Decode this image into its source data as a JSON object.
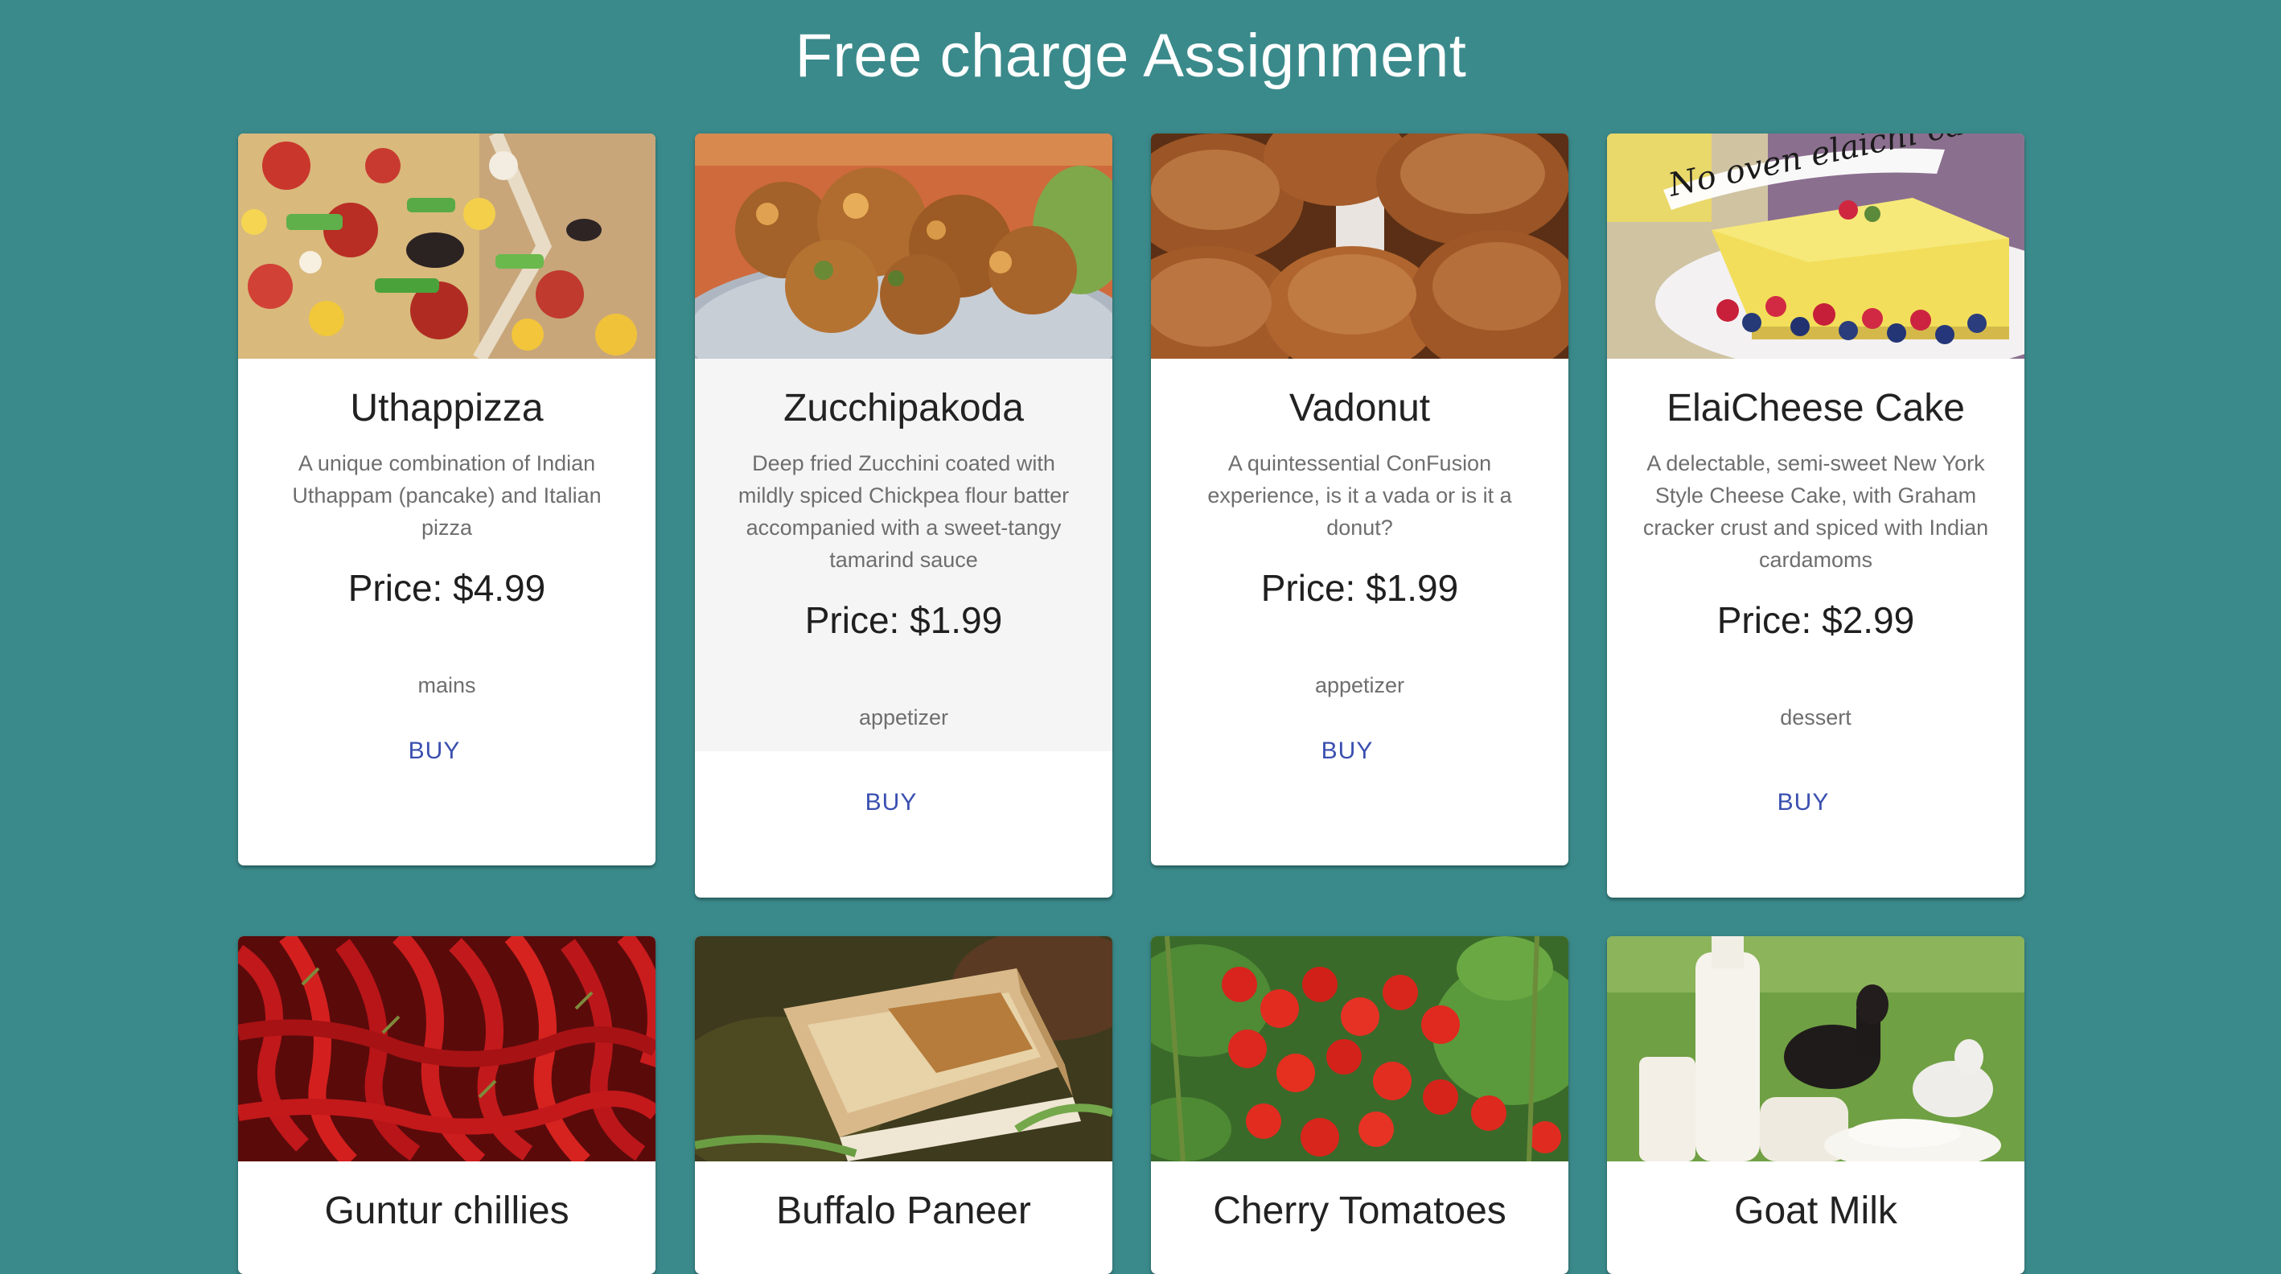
{
  "page": {
    "title": "Free charge Assignment"
  },
  "colors": {
    "background": "#3b8a8b",
    "card": "#ffffff",
    "highlight_card_body": "#f5f5f5",
    "buy_button": "#3a4fb0"
  },
  "dishes": [
    {
      "name": "Uthappizza",
      "image": "pizza-image",
      "description": "A unique combination of Indian Uthappam (pancake) and Italian pizza",
      "price": "Price: $4.99",
      "category": "mains",
      "buy_label": "BUY"
    },
    {
      "name": "Zucchipakoda",
      "image": "pakoda-image",
      "description": "Deep fried Zucchini coated with mildly spiced Chickpea flour batter accompanied with a sweet-tangy tamarind sauce",
      "price": "Price: $1.99",
      "category": "appetizer",
      "buy_label": "BUY"
    },
    {
      "name": "Vadonut",
      "image": "vadonut-image",
      "description": "A quintessential ConFusion experience, is it a vada or is it a donut?",
      "price": "Price: $1.99",
      "category": "appetizer",
      "buy_label": "BUY"
    },
    {
      "name": "ElaiCheese Cake",
      "image": "cheesecake-image",
      "image_caption": "No oven elaichi cake",
      "description": "A delectable, semi-sweet New York Style Cheese Cake, with Graham cracker crust and spiced with Indian cardamoms",
      "price": "Price: $2.99",
      "category": "dessert",
      "buy_label": "BUY"
    },
    {
      "name": "Guntur chillies",
      "image": "chillies-image"
    },
    {
      "name": "Buffalo Paneer",
      "image": "paneer-image"
    },
    {
      "name": "Cherry Tomatoes",
      "image": "tomatoes-image"
    },
    {
      "name": "Goat Milk",
      "image": "goat-milk-image"
    }
  ]
}
